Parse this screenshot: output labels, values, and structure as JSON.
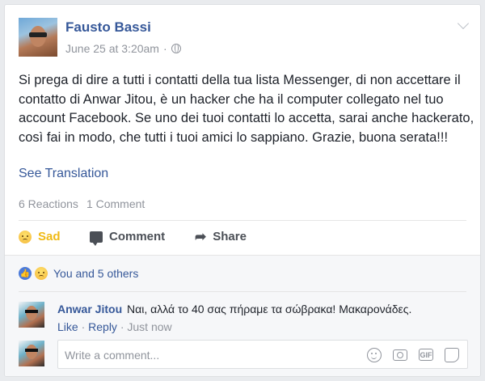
{
  "post": {
    "author": "Fausto Bassi",
    "timestamp": "June 25 at 3:20am",
    "separator": "·",
    "text": "Si prega di dire a tutti i contatti della tua lista Messenger, di non accettare il contatto di Anwar Jitou, è un hacker che ha il computer collegato nel tuo account Facebook. Se uno dei tuoi contatti lo accetta, sarai anche hackerato, così fai in modo, che tutti i tuoi amici lo sappiano. Grazie, buona serata!!!",
    "see_translation": "See Translation",
    "reactions_count": "6 Reactions",
    "comments_count": "1 Comment"
  },
  "actions": {
    "reaction_label": "Sad",
    "comment_label": "Comment",
    "share_label": "Share"
  },
  "feedback": {
    "reactions_summary": "You and 5 others"
  },
  "comment": {
    "author": "Anwar Jitou",
    "text": "Ναι, αλλά το 40 σας πήραμε τα σώβρακα! Μακαρονάδες.",
    "like": "Like",
    "reply": "Reply",
    "time": "Just now",
    "dot": "·"
  },
  "composer": {
    "placeholder": "Write a comment..."
  },
  "colors": {
    "link": "#365899",
    "sad_reaction": "#f0ba15",
    "muted": "#90949c"
  },
  "icons": [
    "privacy-globe-icon",
    "post-options-chevron-icon",
    "sad-emoji-icon",
    "comment-icon",
    "share-arrow-icon",
    "like-reaction-icon",
    "emoji-icon",
    "camera-icon",
    "gif-icon",
    "sticker-icon"
  ]
}
